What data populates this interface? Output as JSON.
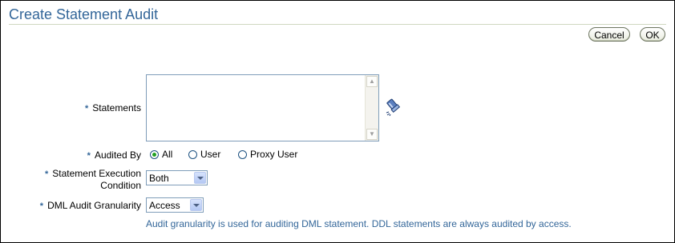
{
  "page": {
    "title": "Create Statement Audit"
  },
  "buttons": {
    "cancel": "Cancel",
    "ok": "OK"
  },
  "required_marker": "*",
  "fields": {
    "statements": {
      "label": "Statements",
      "value": "",
      "flashlight_icon": "flashlight-search-icon"
    },
    "audited_by": {
      "label": "Audited By",
      "options": [
        "All",
        "User",
        "Proxy User"
      ],
      "selected": "All"
    },
    "condition": {
      "label_line1": "Statement Execution",
      "label_line2": "Condition",
      "value": "Both"
    },
    "dml": {
      "label": "DML Audit Granularity",
      "value": "Access"
    }
  },
  "help_text": "Audit granularity is used for auditing DML statement. DDL statements are always audited by access.",
  "colors": {
    "title": "#336699",
    "required": "#336699",
    "help": "#336699"
  }
}
